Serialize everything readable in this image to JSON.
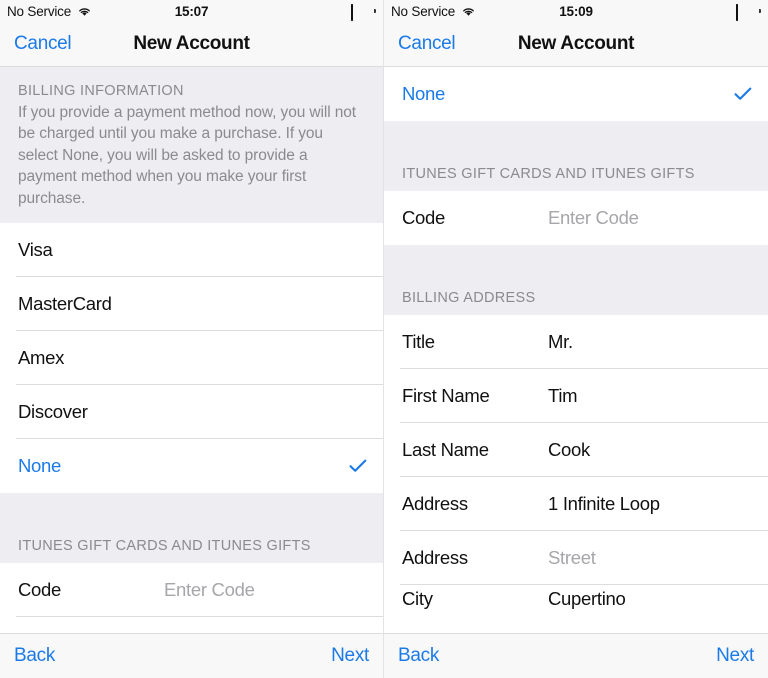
{
  "panels": [
    {
      "id": "left",
      "status_bar": {
        "carrier": "No Service",
        "wifi_icon": "wifi-icon",
        "time": "15:07",
        "battery_icon": "battery-full-icon"
      },
      "nav": {
        "cancel_label": "Cancel",
        "title": "New Account"
      },
      "billing_info": {
        "section_title": "BILLING INFORMATION",
        "description": "If you provide a payment method now, you will not be charged until you make a purchase. If you select None, you will be asked to provide a payment method when you make your first purchase."
      },
      "payment_methods": [
        {
          "label": "Visa",
          "selected": false
        },
        {
          "label": "MasterCard",
          "selected": false
        },
        {
          "label": "Amex",
          "selected": false
        },
        {
          "label": "Discover",
          "selected": false
        },
        {
          "label": "None",
          "selected": true
        }
      ],
      "gift_section_title": "ITUNES GIFT CARDS AND ITUNES GIFTS",
      "code_row": {
        "label": "Code",
        "placeholder": "Enter Code",
        "value": ""
      },
      "toolbar": {
        "back_label": "Back",
        "next_label": "Next"
      }
    },
    {
      "id": "right",
      "status_bar": {
        "carrier": "No Service",
        "wifi_icon": "wifi-icon",
        "time": "15:09",
        "battery_icon": "battery-full-icon"
      },
      "nav": {
        "cancel_label": "Cancel",
        "title": "New Account"
      },
      "none_row": {
        "label": "None",
        "selected": true
      },
      "gift_section_title": "ITUNES GIFT CARDS AND ITUNES GIFTS",
      "code_row": {
        "label": "Code",
        "placeholder": "Enter Code",
        "value": ""
      },
      "billing_address_title": "BILLING ADDRESS",
      "address_fields": [
        {
          "label": "Title",
          "value": "Mr.",
          "is_placeholder": false
        },
        {
          "label": "First Name",
          "value": "Tim",
          "is_placeholder": false
        },
        {
          "label": "Last Name",
          "value": "Cook",
          "is_placeholder": false
        },
        {
          "label": "Address",
          "value": "1 Infinite Loop",
          "is_placeholder": false
        },
        {
          "label": "Address",
          "value": "Street",
          "is_placeholder": true
        },
        {
          "label": "City",
          "value": "Cupertino",
          "is_placeholder": false
        }
      ],
      "toolbar": {
        "back_label": "Back",
        "next_label": "Next"
      }
    }
  ],
  "colors": {
    "accent_blue": "#1b7ae8",
    "section_grey": "#eeeef2",
    "separator": "#dcdce0",
    "placeholder_grey": "#a6a6ab",
    "bar_background": "#f8f8f8"
  }
}
